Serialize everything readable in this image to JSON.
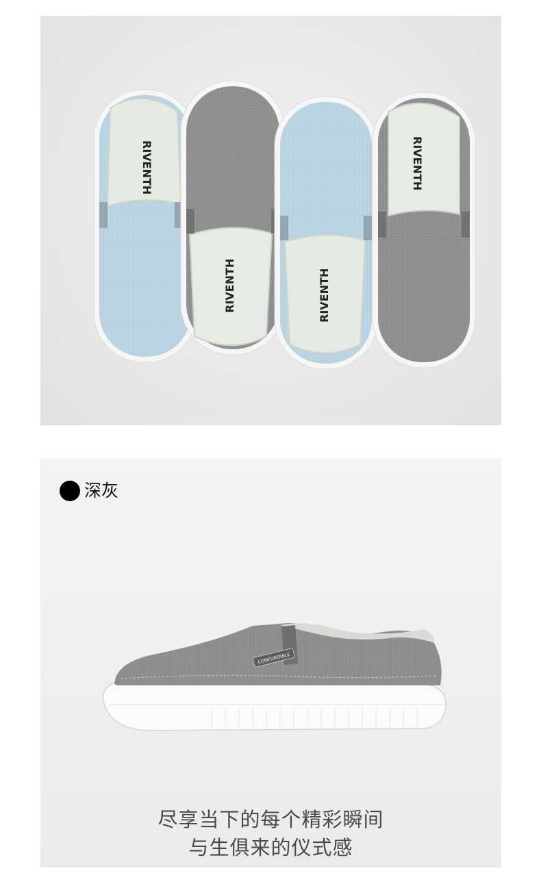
{
  "top_photo": {
    "brand_text": "RIVENTH",
    "colors": {
      "light_blue": "#b9d4e2",
      "gray": "#8f8f91",
      "sole": "#f7f7f7",
      "insole": "#e6ece4"
    }
  },
  "bottom_photo": {
    "color_tag": {
      "dot_icon": "black-circle-icon",
      "label": "深灰"
    },
    "shoe_tag_text": "COMFORTABLE",
    "caption": {
      "line1": "尽享当下的每个精彩瞬间",
      "line2": "与生俱来的仪式感"
    }
  }
}
